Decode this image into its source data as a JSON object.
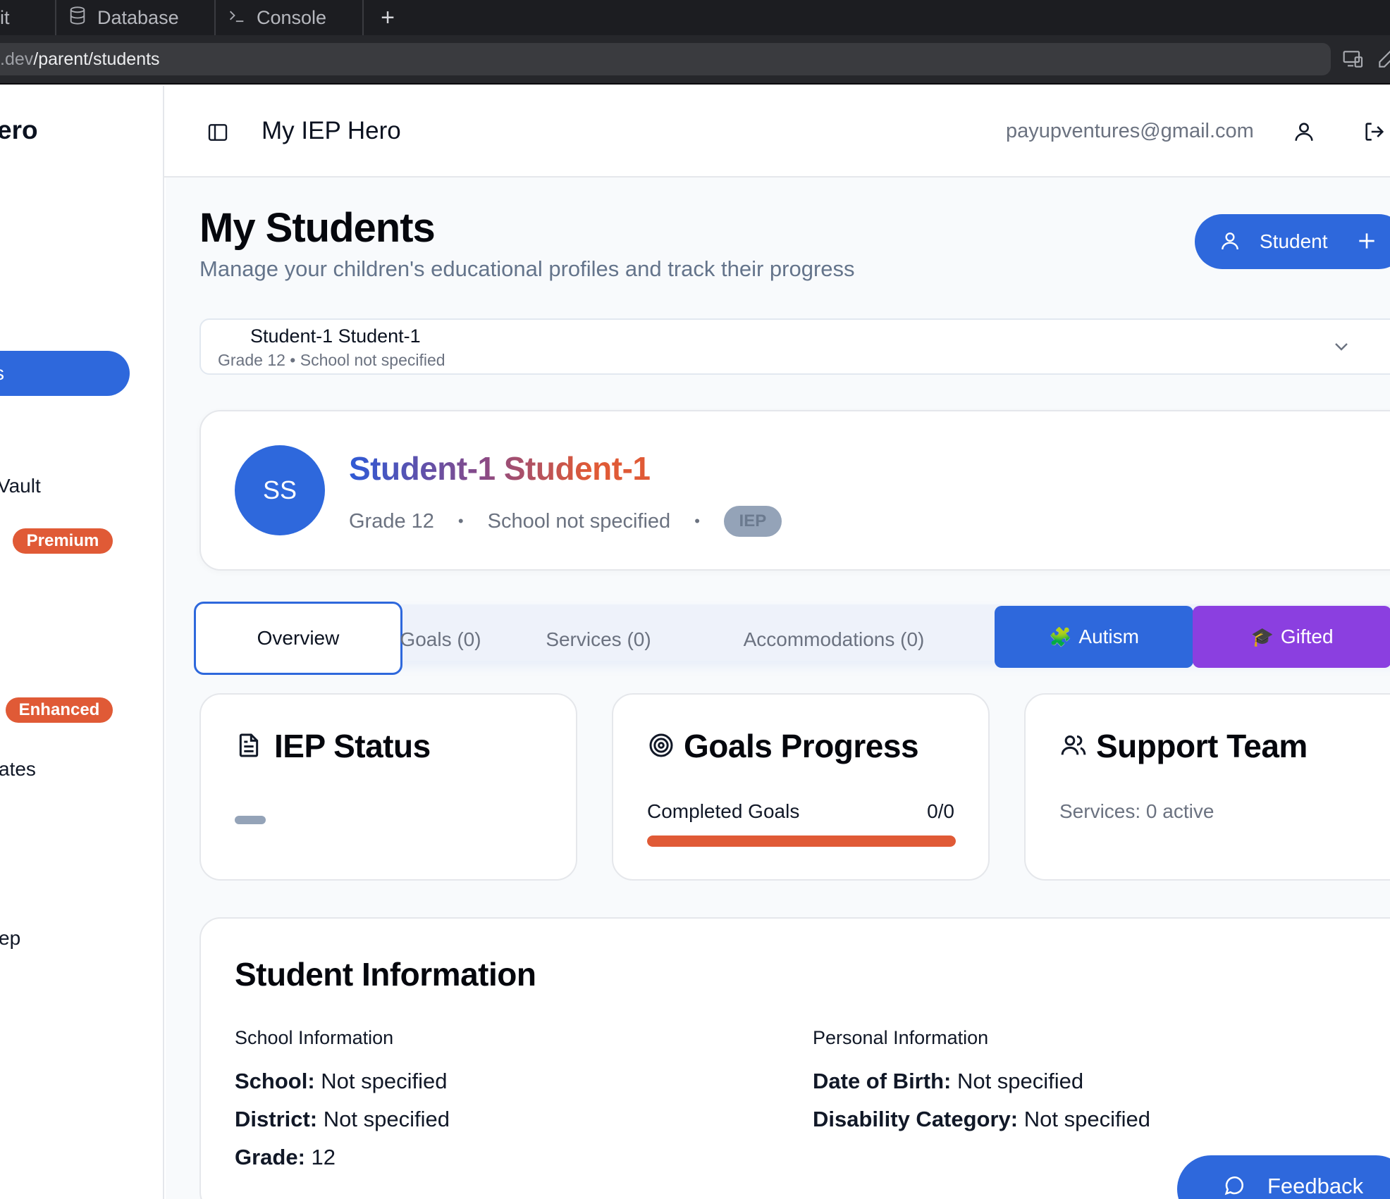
{
  "browser": {
    "tabs": [
      {
        "label": "it",
        "icon": "git-icon"
      },
      {
        "label": "Database",
        "icon": "database-icon"
      },
      {
        "label": "Console",
        "icon": "terminal-icon"
      }
    ],
    "new_tab": "+",
    "url_host": ".dev",
    "url_path": "/parent/students"
  },
  "sidebar": {
    "brand": "ero",
    "active_item": "s",
    "items": [
      {
        "label": "Vault"
      },
      {
        "label": "ates"
      },
      {
        "label": "ep"
      }
    ],
    "badges": {
      "premium": "Premium",
      "enhanced": "Enhanced"
    }
  },
  "header": {
    "title": "My IEP Hero",
    "email": "payupventures@gmail.com"
  },
  "page": {
    "title": "My Students",
    "subtitle": "Manage your children's educational profiles and track their progress",
    "add_button": "Student"
  },
  "student_select": {
    "name": "Student-1 Student-1",
    "meta": "Grade 12 • School not specified"
  },
  "profile": {
    "initials": "SS",
    "name": "Student-1 Student-1",
    "grade": "Grade 12",
    "school": "School not specified",
    "separator": "•",
    "badge": "IEP"
  },
  "tabs": {
    "overview": "Overview",
    "goals": "Goals (0)",
    "services": "Services (0)",
    "accommodations": "Accommodations (0)",
    "autism": "Autism",
    "autism_emoji": "🧩",
    "gifted": "Gifted",
    "gifted_emoji": "🎓"
  },
  "cards": {
    "iep_status": {
      "title": "IEP Status"
    },
    "goals_progress": {
      "title": "Goals Progress",
      "label": "Completed Goals",
      "value": "0/0",
      "progress_fraction": 1.0
    },
    "support_team": {
      "title": "Support Team",
      "line": "Services: 0 active"
    }
  },
  "student_info": {
    "title": "Student Information",
    "school_section": {
      "heading": "School Information",
      "school_label": "School:",
      "school_value": "Not specified",
      "district_label": "District:",
      "district_value": "Not specified",
      "grade_label": "Grade:",
      "grade_value": "12"
    },
    "personal_section": {
      "heading": "Personal Information",
      "dob_label": "Date of Birth:",
      "dob_value": "Not specified",
      "disability_label": "Disability Category:",
      "disability_value": "Not specified"
    }
  },
  "feedback": {
    "label": "Feedback"
  },
  "colors": {
    "primary": "#2e68dc",
    "accent_orange": "#e05a36",
    "purple": "#8b3fe0"
  }
}
